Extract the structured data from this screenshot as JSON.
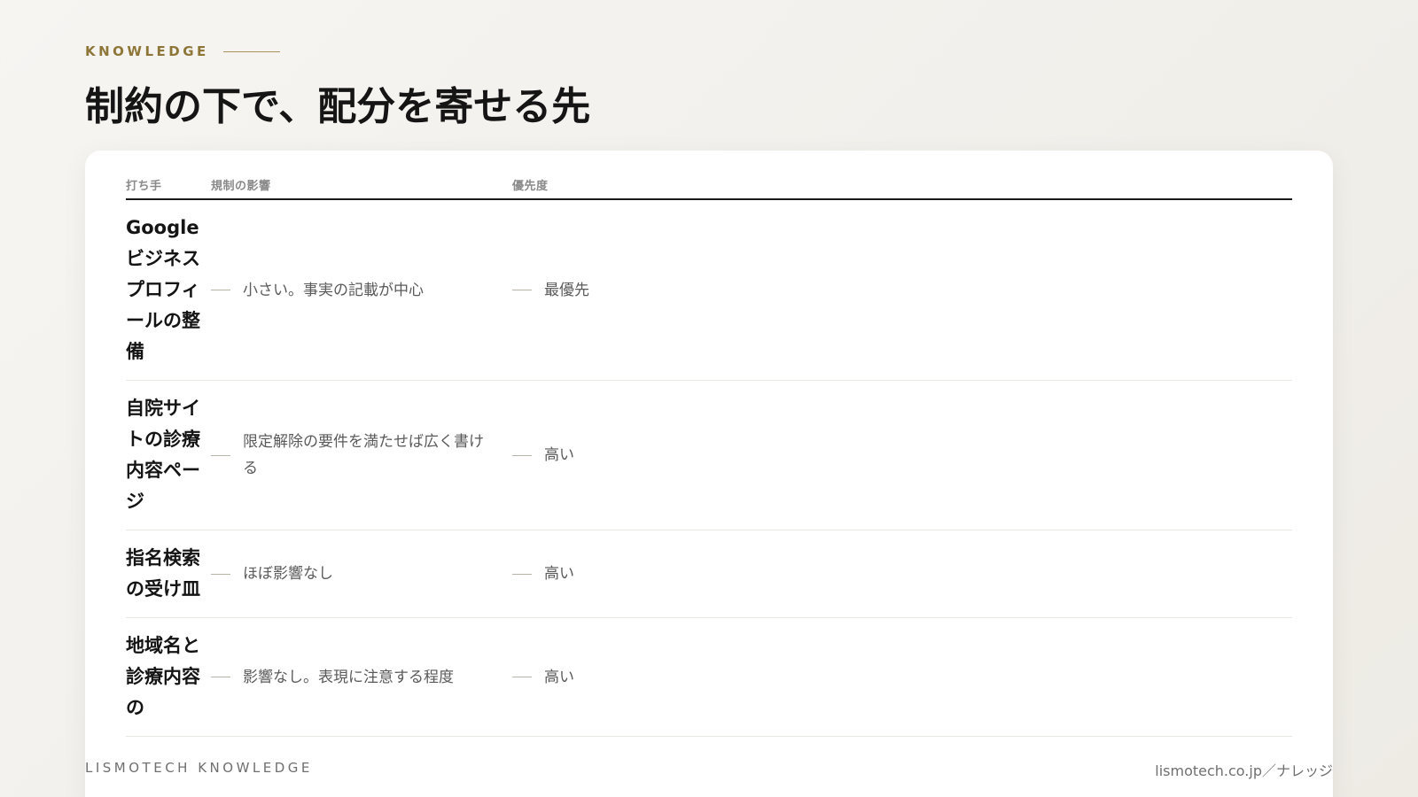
{
  "eyebrow": "KNOWLEDGE",
  "title": "制約の下で、配分を寄せる先",
  "table": {
    "headers": [
      "打ち手",
      "規制の影響",
      "優先度"
    ],
    "rows": [
      {
        "action": "Googleビジネスプロフィールの整備",
        "impact": "小さい。事実の記載が中心",
        "priority": "最優先"
      },
      {
        "action": "自院サイトの診療内容ページ",
        "impact": "限定解除の要件を満たせば広く書ける",
        "priority": "高い"
      },
      {
        "action": "指名検索の受け皿",
        "impact": "ほぼ影響なし",
        "priority": "高い"
      },
      {
        "action": "地域名と診療内容の",
        "impact": "影響なし。表現に注意する程度",
        "priority": "高い"
      }
    ]
  },
  "footer": {
    "brand": "LISMOTECH KNOWLEDGE",
    "url": "lismotech.co.jp／ナレッジ"
  }
}
